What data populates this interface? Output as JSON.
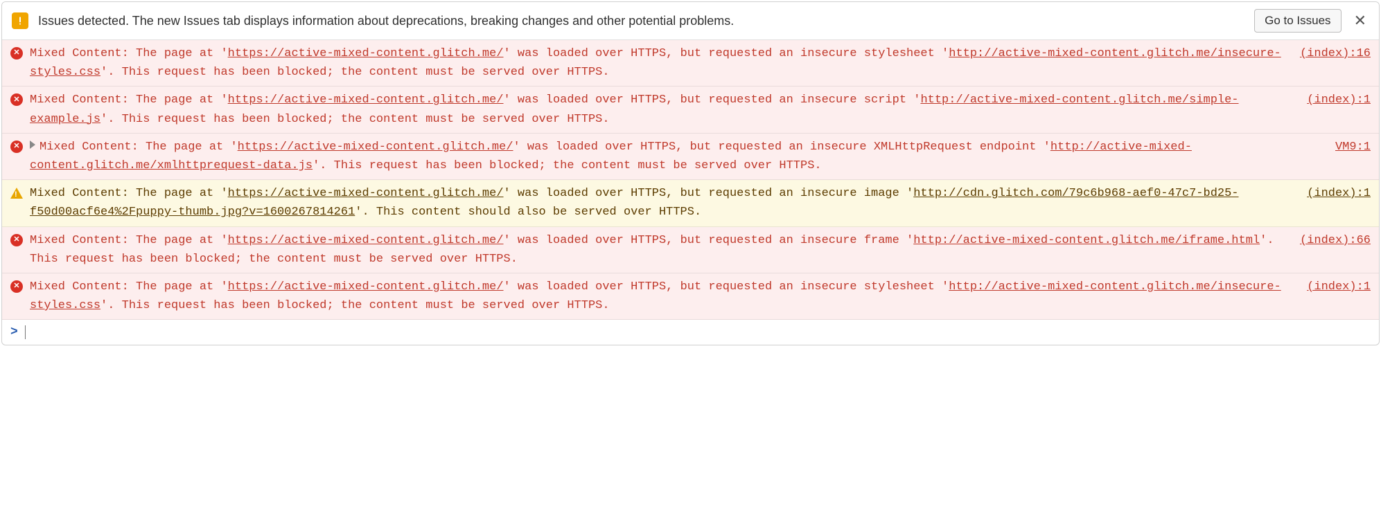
{
  "banner": {
    "text": "Issues detected. The new Issues tab displays information about deprecations, breaking changes and other potential problems.",
    "button": "Go to Issues",
    "close": "✕"
  },
  "logs": [
    {
      "level": "error",
      "expandable": false,
      "pre1": "Mixed Content: The page at '",
      "url1": "https://active-mixed-content.glitch.me/",
      "mid1": "' was loaded over HTTPS, but requested an insecure stylesheet '",
      "url2": "http://active-mixed-content.glitch.me/insecure-styles.css",
      "post1": "'. This request has been blocked; the content must be served over HTTPS.",
      "source": "(index):16"
    },
    {
      "level": "error",
      "expandable": false,
      "pre1": "Mixed Content: The page at '",
      "url1": "https://active-mixed-content.glitch.me/",
      "mid1": "' was loaded over HTTPS, but requested an insecure script '",
      "url2": "http://active-mixed-content.glitch.me/simple-example.js",
      "post1": "'. This request has been blocked; the content must be served over HTTPS.",
      "source": "(index):1"
    },
    {
      "level": "error",
      "expandable": true,
      "pre1": "Mixed Content: The page at '",
      "url1": "https://active-mixed-content.glitch.me/",
      "mid1": "' was loaded over HTTPS, but requested an insecure XMLHttpRequest endpoint '",
      "url2": "http://active-mixed-content.glitch.me/xmlhttprequest-data.js",
      "post1": "'. This request has been blocked; the content must be served over HTTPS.",
      "source": "VM9:1"
    },
    {
      "level": "warning",
      "expandable": false,
      "pre1": "Mixed Content: The page at '",
      "url1": "https://active-mixed-content.glitch.me/",
      "mid1": "' was loaded over HTTPS, but requested an insecure image '",
      "url2": "http://cdn.glitch.com/79c6b968-aef0-47c7-bd25-f50d00acf6e4%2Fpuppy-thumb.jpg?v=1600267814261",
      "post1": "'. This content should also be served over HTTPS.",
      "source": "(index):1"
    },
    {
      "level": "error",
      "expandable": false,
      "pre1": "Mixed Content: The page at '",
      "url1": "https://active-mixed-content.glitch.me/",
      "mid1": "' was loaded over HTTPS, but requested an insecure frame '",
      "url2": "http://active-mixed-content.glitch.me/iframe.html",
      "post1": "'. This request has been blocked; the content must be served over HTTPS.",
      "source": "(index):66"
    },
    {
      "level": "error",
      "expandable": false,
      "pre1": "Mixed Content: The page at '",
      "url1": "https://active-mixed-content.glitch.me/",
      "mid1": "' was loaded over HTTPS, but requested an insecure stylesheet '",
      "url2": "http://active-mixed-content.glitch.me/insecure-styles.css",
      "post1": "'. This request has been blocked; the content must be served over HTTPS.",
      "source": "(index):1"
    }
  ],
  "prompt": ">"
}
